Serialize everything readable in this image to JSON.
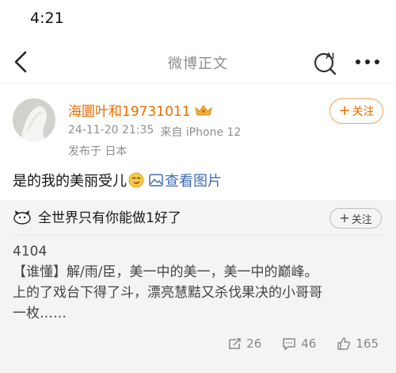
{
  "status_bar": {
    "time": "4:21"
  },
  "nav": {
    "title": "微博正文",
    "ai_icon": "ai-search-icon",
    "more_icon": "more-dots-icon",
    "back_icon": "back-chevron-icon"
  },
  "post": {
    "username": "海圜叶和19731011",
    "timestamp": "24-11-20 21:35",
    "source": "来自 iPhone 12",
    "location": "发布于 日本",
    "follow_label": "关注",
    "text_main": "是的我的美丽受儿",
    "view_pictures": "查看图片"
  },
  "repost": {
    "author": "全世界只有你能做1好了",
    "follow_label": "关注",
    "lines": [
      "4104",
      "【谁懂】解/雨/臣，美一中的美一，美一中的巅峰。",
      "上的了戏台下得了斗，漂亮慧黠又杀伐果决的小哥哥",
      "一枚……"
    ],
    "reposts": "26",
    "comments": "46",
    "likes": "165"
  },
  "colors": {
    "accent": "#ea6d00",
    "link": "#3f6cb3",
    "muted": "#8e8e8e",
    "card_bg": "#f4f4f4"
  }
}
